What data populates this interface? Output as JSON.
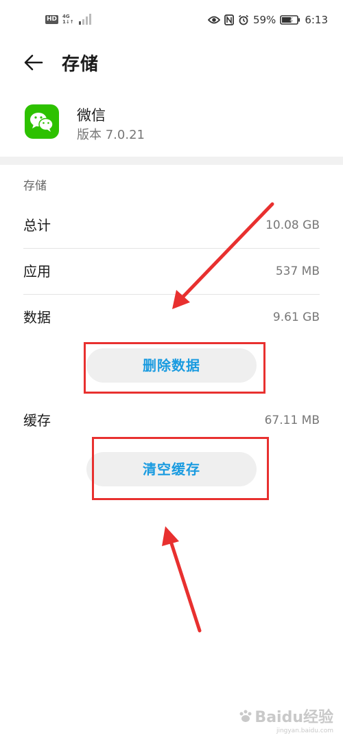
{
  "status_bar": {
    "hd_badge": "HD",
    "network_type": "4G",
    "network_sub": "1↓↑",
    "battery_percent": "59%",
    "time": "6:13",
    "icons": [
      "eye-icon",
      "nfc-icon",
      "alarm-icon",
      "battery-icon",
      "signal-icon"
    ]
  },
  "header": {
    "title": "存储",
    "back_icon": "back-arrow-icon"
  },
  "app": {
    "name": "微信",
    "version": "版本 7.0.21",
    "icon": "wechat-icon",
    "icon_color": "#2dc100"
  },
  "storage": {
    "section_label": "存储",
    "rows": [
      {
        "label": "总计",
        "value": "10.08 GB"
      },
      {
        "label": "应用",
        "value": "537 MB"
      },
      {
        "label": "数据",
        "value": "9.61 GB"
      }
    ],
    "delete_data_button": "删除数据",
    "cache": {
      "label": "缓存",
      "value": "67.11 MB"
    },
    "clear_cache_button": "清空缓存"
  },
  "annotations": {
    "highlight_color": "#e8302f",
    "button_text_color": "#1a9be0"
  },
  "watermark": {
    "main": "Baidu经验",
    "sub": "jingyan.baidu.com"
  }
}
